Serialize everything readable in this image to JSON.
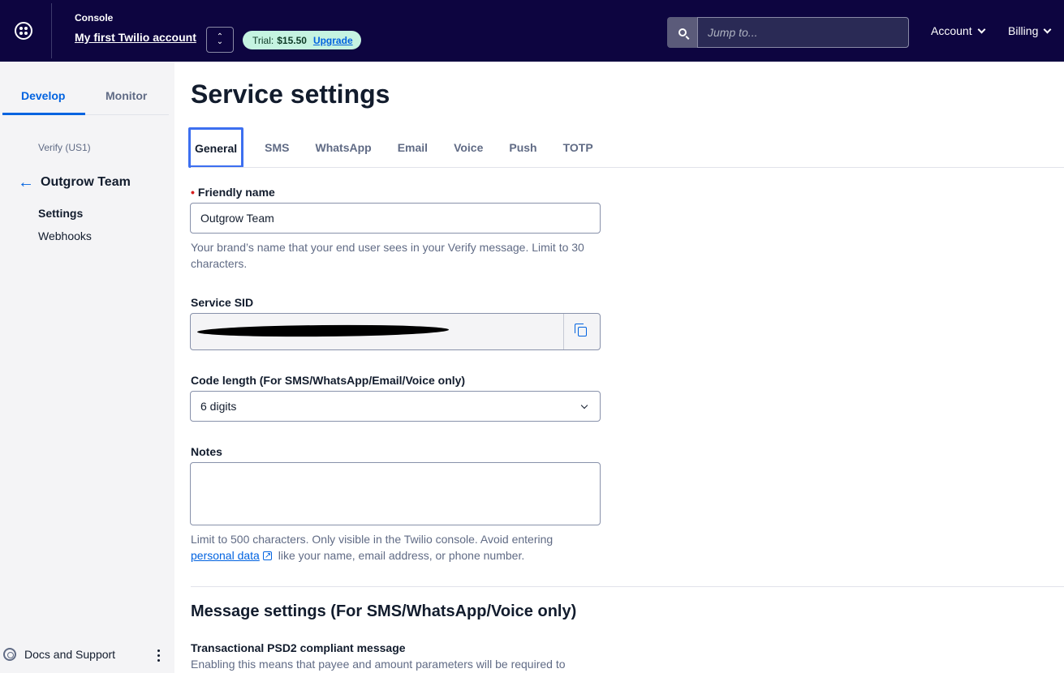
{
  "topbar": {
    "console_label": "Console",
    "account_name": "My first Twilio account",
    "trial_label": "Trial:",
    "trial_balance": "$15.50",
    "upgrade_label": "Upgrade",
    "search_placeholder": "Jump to...",
    "account_menu": "Account",
    "billing_menu": "Billing"
  },
  "sidebar": {
    "tabs": [
      {
        "label": "Develop",
        "active": true
      },
      {
        "label": "Monitor",
        "active": false
      }
    ],
    "section": "Verify (US1)",
    "back_title": "Outgrow Team",
    "links": [
      {
        "label": "Settings",
        "active": true
      },
      {
        "label": "Webhooks",
        "active": false
      }
    ],
    "docs_support": "Docs and Support"
  },
  "main": {
    "title": "Service settings",
    "tabs": [
      "General",
      "SMS",
      "WhatsApp",
      "Email",
      "Voice",
      "Push",
      "TOTP"
    ],
    "active_tab": "General",
    "friendly_name": {
      "required_marker": "•",
      "label": "Friendly name",
      "value": "Outgrow Team",
      "help": "Your brand’s name that your end user sees in your Verify message. Limit to 30 characters."
    },
    "service_sid": {
      "label": "Service SID"
    },
    "code_length": {
      "label": "Code length (For SMS/WhatsApp/Email/Voice only)",
      "value": "6 digits"
    },
    "notes": {
      "label": "Notes",
      "value": "",
      "help_before": "Limit to 500 characters. Only visible in the Twilio console. Avoid entering ",
      "help_link": "personal data",
      "help_after": " like your name, email address, or phone number."
    },
    "message_settings": {
      "title": "Message settings (For SMS/WhatsApp/Voice only)",
      "psd2_label": "Transactional PSD2 compliant message",
      "psd2_help": "Enabling this means that payee and amount parameters will be required to"
    }
  },
  "colors": {
    "topbar_bg": "#0d0540",
    "accent": "#0263e0",
    "trial_badge_bg": "#c5f3e1",
    "sidebar_bg": "#f4f4f6"
  }
}
